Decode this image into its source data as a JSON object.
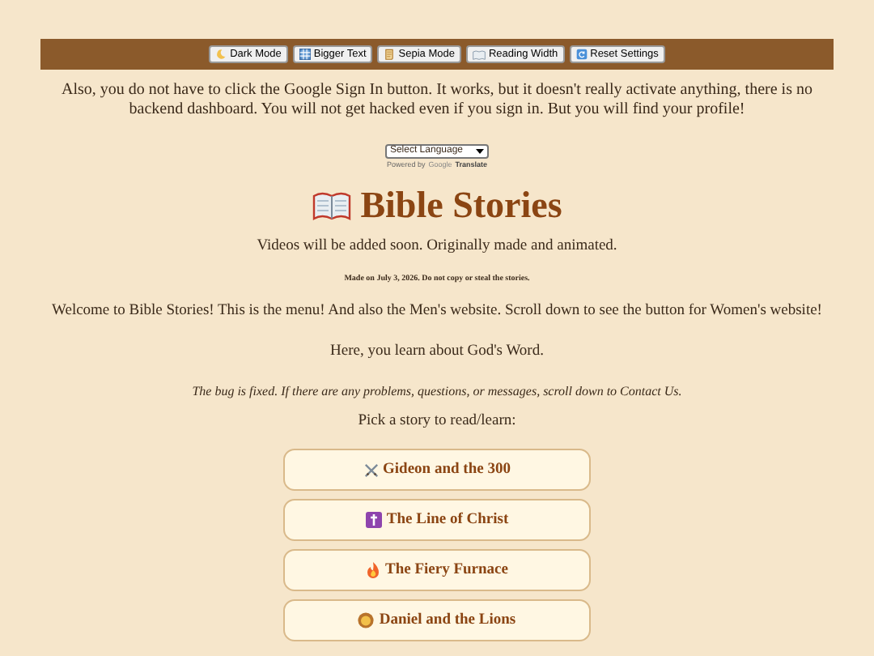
{
  "toolbar": {
    "buttons": [
      {
        "label": "Dark Mode",
        "kind": "moon"
      },
      {
        "label": "Bigger Text",
        "kind": "grid"
      },
      {
        "label": "Sepia Mode",
        "kind": "scroll"
      },
      {
        "label": "Reading Width",
        "kind": "book"
      },
      {
        "label": "Reset Settings",
        "kind": "reset"
      }
    ]
  },
  "notice": "Also, you do not have to click the Google Sign In button. It works, but it doesn't really activate anything, there is no backend dashboard. You will not get hacked even if you sign in. But you will find your profile!",
  "translate": {
    "select": "Select Language",
    "powered_by": "Powered by",
    "google": "Google",
    "translate": "Translate"
  },
  "title": "Bible Stories",
  "subtitle": "Videos will be added soon. Originally made and animated.",
  "made_on": "Made on July 3, 2026. Do not copy or steal the stories.",
  "welcome": "Welcome to Bible Stories! This is the menu! And also the Men's website. Scroll down to see the button for Women's website!",
  "learn": "Here, you learn about God's Word.",
  "bug_note": "The bug is fixed. If there are any problems, questions, or messages, scroll down to Contact Us.",
  "pick": "Pick a story to read/learn:",
  "stories": [
    {
      "label": "Gideon and the 300",
      "kind": "swords"
    },
    {
      "label": "The Line of Christ",
      "kind": "cross"
    },
    {
      "label": "The Fiery Furnace",
      "kind": "fire"
    },
    {
      "label": "Daniel and the Lions",
      "kind": "lion"
    }
  ]
}
